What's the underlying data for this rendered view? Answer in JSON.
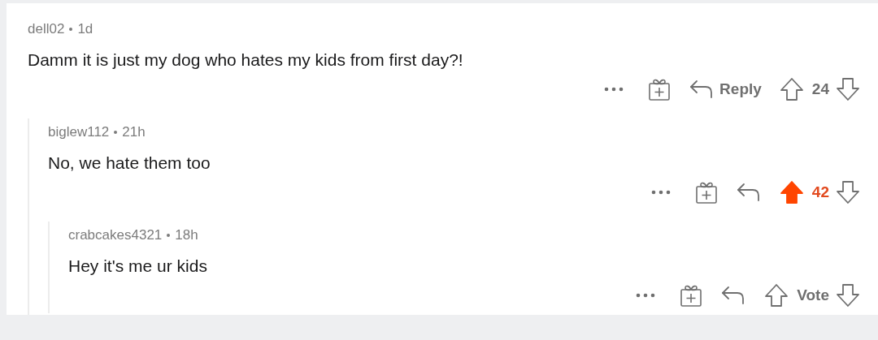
{
  "comments": [
    {
      "author": "dell02",
      "age": "1d",
      "body": "Damm it is just my dog who hates my kids from first day?!",
      "reply_label": "Reply",
      "vote_label": "24",
      "upvoted": false,
      "children": [
        {
          "author": "biglew112",
          "age": "21h",
          "body": "No, we hate them too",
          "vote_label": "42",
          "upvoted": true,
          "children": [
            {
              "author": "crabcakes4321",
              "age": "18h",
              "body": "Hey it's me ur kids",
              "vote_label": "Vote",
              "upvoted": false
            }
          ]
        }
      ]
    }
  ]
}
